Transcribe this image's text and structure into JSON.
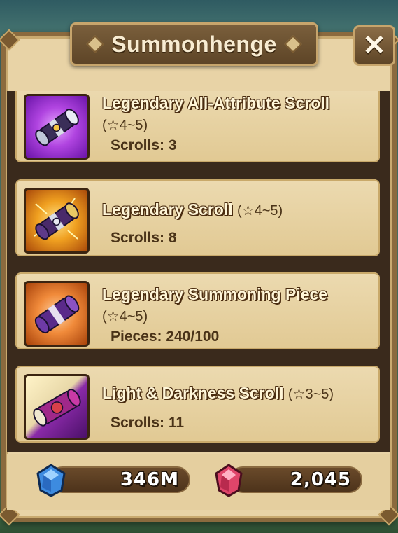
{
  "window": {
    "title": "Summonhenge",
    "close_label": "✕"
  },
  "items": [
    {
      "name": "Legendary All-Attribute Scroll",
      "grade": "(☆4~5)",
      "count": "Scrolls: 3",
      "icon": "all-attribute-scroll-icon"
    },
    {
      "name": "Legendary Scroll",
      "grade": "(☆4~5)",
      "count": "Scrolls: 8",
      "icon": "legendary-scroll-icon"
    },
    {
      "name": "Legendary Summoning Piece",
      "grade": "(☆4~5)",
      "count": "Pieces: 240/100",
      "icon": "summoning-piece-icon"
    },
    {
      "name": "Light & Darkness Scroll",
      "grade": "(☆3~5)",
      "count": "Scrolls: 11",
      "icon": "light-darkness-scroll-icon"
    }
  ],
  "currency": {
    "mana": {
      "value": "346M",
      "icon": "mana-crystal-icon",
      "color": "#3d8be0"
    },
    "crystal": {
      "value": "2,045",
      "icon": "crystal-gem-icon",
      "color": "#e0456a"
    }
  }
}
